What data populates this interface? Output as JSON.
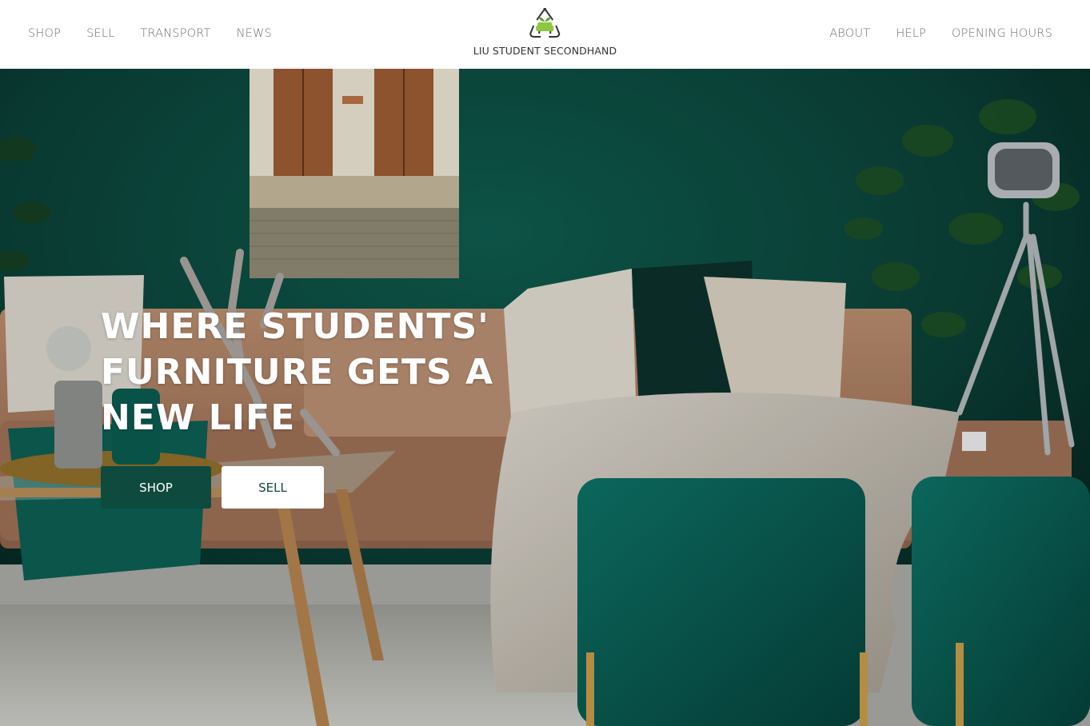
{
  "site": {
    "brand": "LIU STUDENT SECONDHAND",
    "logo_icon": "recycle-sofa-icon"
  },
  "nav": {
    "left": [
      {
        "label": "SHOP"
      },
      {
        "label": "SELL"
      },
      {
        "label": "TRANSPORT"
      },
      {
        "label": "NEWS"
      }
    ],
    "right": [
      {
        "label": "ABOUT"
      },
      {
        "label": "HELP"
      },
      {
        "label": "OPENING HOURS"
      }
    ]
  },
  "hero": {
    "headline": "WHERE STUDENTS' FURNITURE GETS A NEW LIFE",
    "shop_button": "SHOP",
    "sell_button": "SELL"
  },
  "colors": {
    "accent": "#0f4a3e",
    "wall": "#0a4a40",
    "nav_text": "#6e6e6e"
  }
}
